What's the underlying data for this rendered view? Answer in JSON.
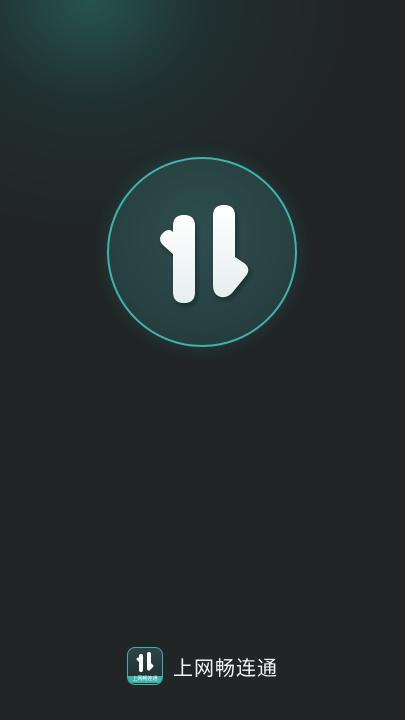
{
  "app": {
    "name": "上网畅连通",
    "icon_label": "上网畅连通",
    "logo_icon": "up-down-arrows-icon"
  },
  "colors": {
    "background": "#212526",
    "accent": "#3fb3ad",
    "logo_fill": "#ffffff"
  }
}
